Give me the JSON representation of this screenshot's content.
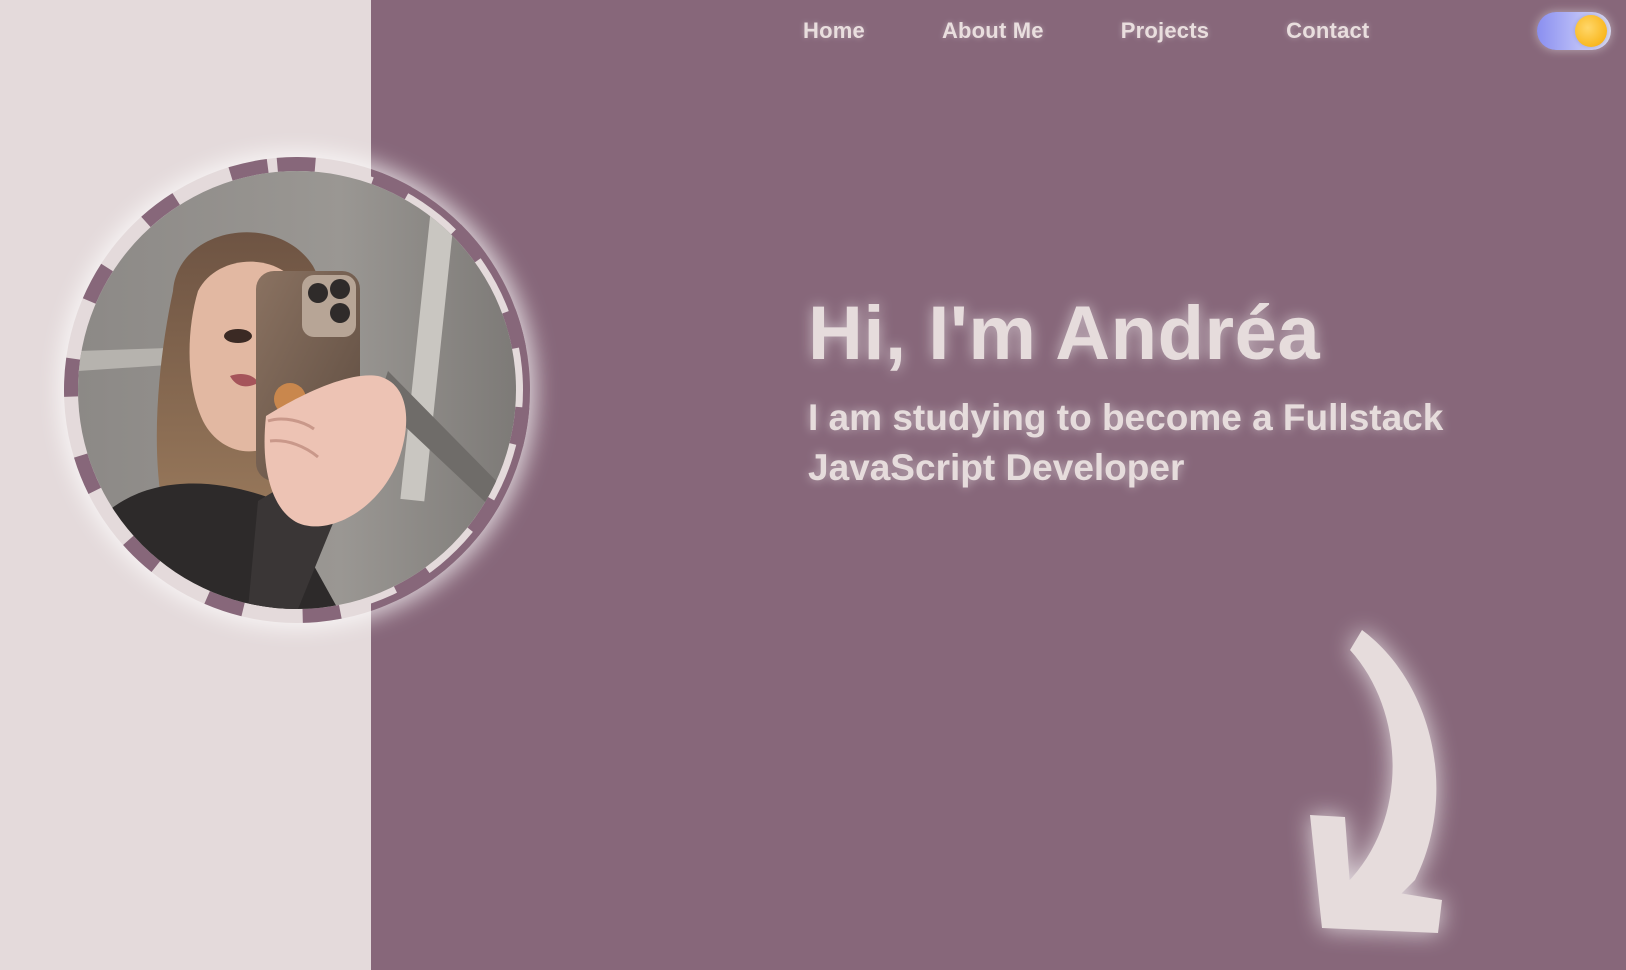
{
  "nav": {
    "items": [
      {
        "label": "Home"
      },
      {
        "label": "About Me"
      },
      {
        "label": "Projects"
      },
      {
        "label": "Contact"
      }
    ]
  },
  "theme_toggle": {
    "icon": "sun-icon",
    "track_color": "#9ea2f4",
    "knob_color": "#f9b820"
  },
  "profile": {
    "avatar_icon": "profile-photo"
  },
  "hero": {
    "title": "Hi, I'm Andréa",
    "subtitle": "I am studying to become a Fullstack JavaScript Developer"
  },
  "scroll_arrow": {
    "icon": "curved-arrow-down-icon"
  },
  "colors": {
    "background": "#87677a",
    "left_panel": "#e4dadb",
    "text": "#e6dcdc"
  }
}
